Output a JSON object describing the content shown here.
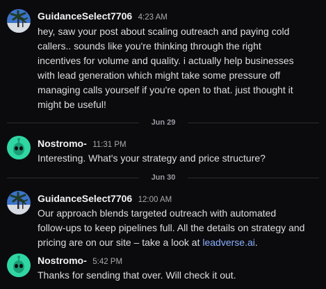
{
  "messages": [
    {
      "author": "GuidanceSelect7706",
      "time": "4:23 AM",
      "avatar_icon": "palm-tree-avatar-icon",
      "lines": [
        "hey, saw your post about scaling outreach and paying cold",
        "callers.. sounds like you're thinking through the right",
        "incentives for volume and quality. i actually help businesses",
        "with lead generation which might take some pressure off",
        "managing calls yourself if you're open to that. just thought it",
        "might be useful!"
      ]
    },
    {
      "author": "Nostromo-",
      "time": "11:31 PM",
      "avatar_icon": "alien-avatar-icon",
      "lines": [
        "Interesting. What's your strategy and price structure?"
      ]
    },
    {
      "author": "GuidanceSelect7706",
      "time": "12:00 AM",
      "avatar_icon": "palm-tree-avatar-icon",
      "lines": [
        "Our approach blends targeted outreach with automated",
        "follow-ups to keep pipelines full. All the details on strategy and"
      ],
      "line3_text": "pricing are on our site – take a look at ",
      "line3_link": "leadverse.ai",
      "line3_end": "."
    },
    {
      "author": "Nostromo-",
      "time": "5:42 PM",
      "avatar_icon": "alien-avatar-icon",
      "lines": [
        "Thanks for sending that over. Will check it out."
      ]
    }
  ],
  "dividers": [
    "Jun 29",
    "Jun 30"
  ],
  "colors": {
    "background": "#0b0b0d",
    "link": "#8ab0ff",
    "alien_avatar": "#2fd6a3",
    "palm_sky": "#3b73c9"
  }
}
